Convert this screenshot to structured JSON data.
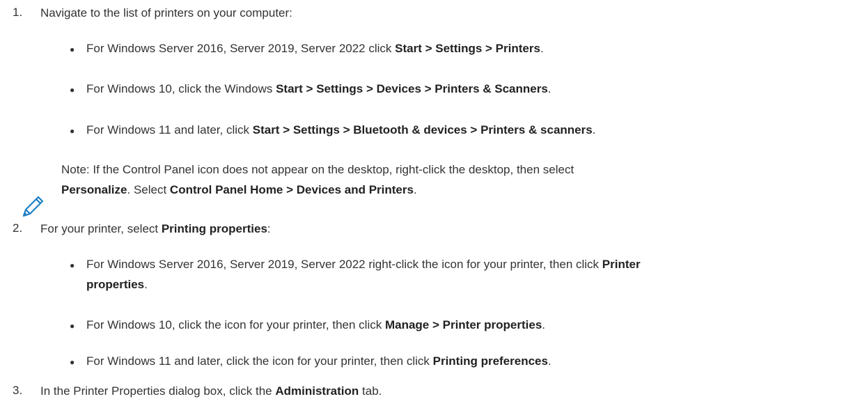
{
  "steps": [
    {
      "num": "1.",
      "text": "Navigate to the list of printers on your computer:",
      "bullets": [
        {
          "pre": "For Windows Server 2016, Server 2019, Server 2022 click ",
          "bold": "Start > Settings > Printers",
          "post": "."
        },
        {
          "pre": "For Windows 10, click the Windows ",
          "bold": "Start > Settings > Devices > Printers & Scanners",
          "post": "."
        },
        {
          "pre": "For Windows 11 and later, click ",
          "bold": "Start > Settings > Bluetooth & devices > Printers & scanners",
          "post": "."
        }
      ],
      "note": {
        "line1": "Note: If the Control Panel icon does not appear on the desktop, right-click the desktop, then select",
        "line2_bold1": "Personalize",
        "line2_mid": ". Select ",
        "line2_bold2": "Control Panel Home > Devices and Printers",
        "line2_post": "."
      }
    },
    {
      "num": "2.",
      "pre": "For your printer, select ",
      "bold": "Printing properties",
      "post": ":",
      "bullets": [
        {
          "pre": "For Windows Server 2016, Server 2019, Server 2022 right-click the icon for your printer, then click ",
          "bold": "Printer",
          "cont_bold": "properties",
          "post": "."
        },
        {
          "pre": "For Windows 10, click the icon for your printer, then click ",
          "bold": "Manage > Printer properties",
          "post": "."
        },
        {
          "pre": "For Windows 11 and later, click the icon for your printer, then click ",
          "bold": "Printing preferences",
          "post": "."
        }
      ]
    },
    {
      "num": "3.",
      "pre": "In the Printer Properties dialog box, click the ",
      "bold": "Administration",
      "post": " tab."
    }
  ],
  "icons": {
    "note": "pencil-note-icon"
  }
}
